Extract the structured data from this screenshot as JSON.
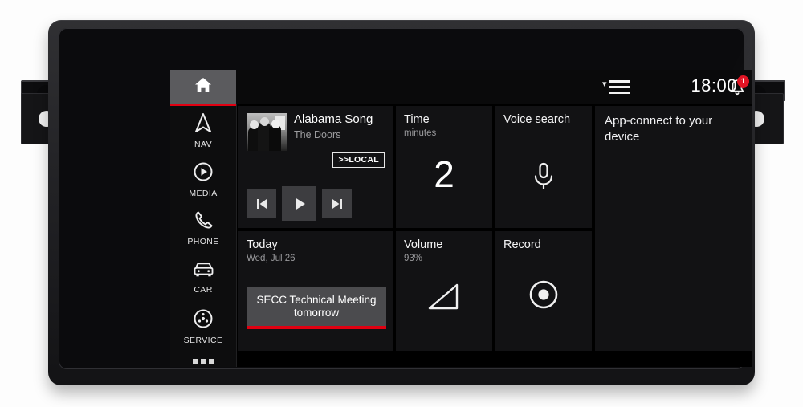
{
  "head_unit": {
    "brand_accent": "#e10012",
    "screen_bg": "#000000",
    "tile_bg": "#121214"
  },
  "sidebar": {
    "home": {
      "icon": "home-icon",
      "label": "HOME",
      "active": true
    },
    "items": [
      {
        "icon": "navigation-arrow-icon",
        "label": "NAV"
      },
      {
        "icon": "play-circle-icon",
        "label": "MEDIA"
      },
      {
        "icon": "phone-handset-icon",
        "label": "PHONE"
      },
      {
        "icon": "car-icon",
        "label": "CAR"
      },
      {
        "icon": "service-wheel-icon",
        "label": "SERVICE"
      }
    ],
    "more": {
      "icon": "more-dots-icon",
      "dots": 3
    }
  },
  "topbar": {
    "menu_icon": "chevron-hamburger-icon",
    "notification_icon": "bell-icon",
    "notification_count": "1",
    "profile_icon": "user-avatar-icon",
    "profile_status_color": "#14b1c4",
    "time": "18:00"
  },
  "tiles": {
    "media": {
      "title": "Alabama Song",
      "artist": "The Doors",
      "source_badge": ">>LOCAL",
      "album_art": "album-art-thumbnail",
      "controls": [
        {
          "name": "previous-track-button",
          "icon": "skip-previous-icon"
        },
        {
          "name": "play-button",
          "icon": "play-icon"
        },
        {
          "name": "next-track-button",
          "icon": "skip-next-icon"
        }
      ]
    },
    "time": {
      "title": "Time",
      "subtitle": "minutes",
      "value": "2"
    },
    "voice": {
      "title": "Voice search",
      "icon": "microphone-icon"
    },
    "app_connect": {
      "title": "App-connect to your device"
    },
    "today": {
      "title": "Today",
      "subtitle": "Wed, Jul 26",
      "event": "SECC Technical Meeting tomorrow",
      "event_accent": "#e00011"
    },
    "volume": {
      "title": "Volume",
      "subtitle": "93%",
      "icon": "volume-ramp-icon"
    },
    "record": {
      "title": "Record",
      "icon": "record-dot-icon"
    }
  }
}
